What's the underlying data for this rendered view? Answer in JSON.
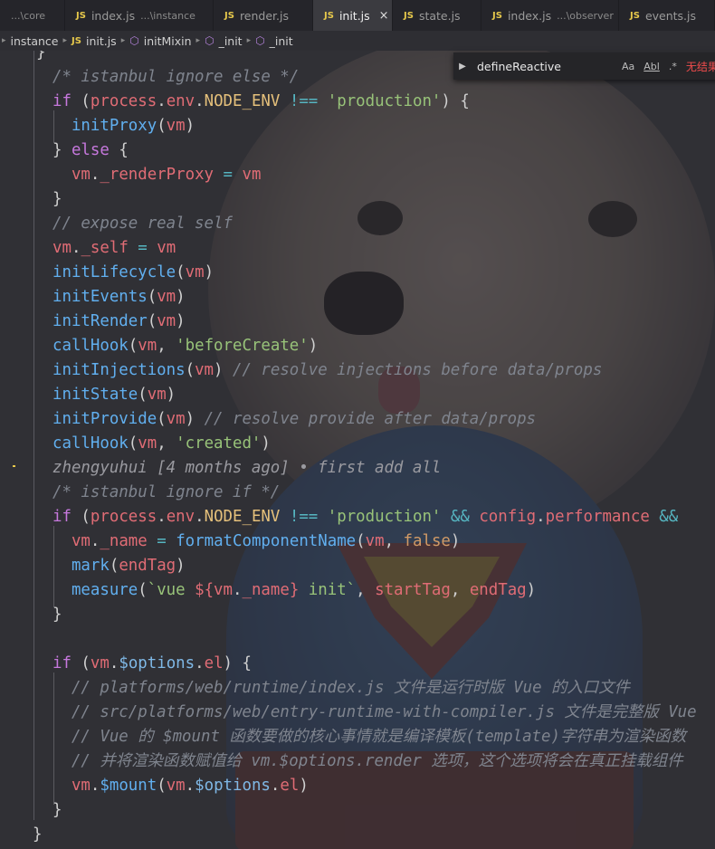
{
  "tabs": [
    {
      "label": "",
      "desc": "...\\core",
      "active": false,
      "js": false
    },
    {
      "label": "index.js",
      "desc": "...\\instance",
      "active": false,
      "js": true
    },
    {
      "label": "render.js",
      "desc": "",
      "active": false,
      "js": true
    },
    {
      "label": "init.js",
      "desc": "",
      "active": true,
      "js": true
    },
    {
      "label": "state.js",
      "desc": "",
      "active": false,
      "js": true
    },
    {
      "label": "index.js",
      "desc": "...\\observer",
      "active": false,
      "js": true
    },
    {
      "label": "events.js",
      "desc": "",
      "active": false,
      "js": true
    }
  ],
  "tab_js_badge": "JS",
  "tab_close_glyph": "×",
  "breadcrumb": {
    "folder": "instance",
    "file": "init.js",
    "symbols": [
      "initMixin",
      "_init",
      "_init"
    ]
  },
  "find": {
    "query": "defineReactive",
    "match_case": "Aa",
    "whole_word": "Abl",
    "regex": ".*",
    "result": "无结果"
  },
  "code": [
    {
      "tokens": [
        [
          "pl",
          "}"
        ]
      ]
    },
    {
      "tokens": [
        [
          "cm",
          "/* istanbul ignore else */"
        ]
      ]
    },
    {
      "tokens": [
        [
          "kw",
          "if"
        ],
        [
          "pl",
          " ("
        ],
        [
          "vr",
          "process"
        ],
        [
          "pl",
          "."
        ],
        [
          "vr",
          "env"
        ],
        [
          "pl",
          "."
        ],
        [
          "pa",
          "NODE_ENV"
        ],
        [
          "pl",
          " "
        ],
        [
          "op",
          "!=="
        ],
        [
          "pl",
          " "
        ],
        [
          "str",
          "'production'"
        ],
        [
          "pl",
          ") {"
        ]
      ]
    },
    {
      "tokens": [
        [
          "pl",
          "  "
        ],
        [
          "fn",
          "initProxy"
        ],
        [
          "pl",
          "("
        ],
        [
          "vr",
          "vm"
        ],
        [
          "pl",
          ")"
        ]
      ]
    },
    {
      "tokens": [
        [
          "pl",
          "} "
        ],
        [
          "kw",
          "else"
        ],
        [
          "pl",
          " {"
        ]
      ]
    },
    {
      "tokens": [
        [
          "pl",
          "  "
        ],
        [
          "vr",
          "vm"
        ],
        [
          "pl",
          "."
        ],
        [
          "vr",
          "_renderProxy"
        ],
        [
          "pl",
          " "
        ],
        [
          "op",
          "="
        ],
        [
          "pl",
          " "
        ],
        [
          "vr",
          "vm"
        ]
      ]
    },
    {
      "tokens": [
        [
          "pl",
          "}"
        ]
      ]
    },
    {
      "tokens": [
        [
          "cm",
          "// expose real self"
        ]
      ]
    },
    {
      "tokens": [
        [
          "vr",
          "vm"
        ],
        [
          "pl",
          "."
        ],
        [
          "vr",
          "_self"
        ],
        [
          "pl",
          " "
        ],
        [
          "op",
          "="
        ],
        [
          "pl",
          " "
        ],
        [
          "vr",
          "vm"
        ]
      ]
    },
    {
      "tokens": [
        [
          "fn",
          "initLifecycle"
        ],
        [
          "pl",
          "("
        ],
        [
          "vr",
          "vm"
        ],
        [
          "pl",
          ")"
        ]
      ]
    },
    {
      "tokens": [
        [
          "fn",
          "initEvents"
        ],
        [
          "pl",
          "("
        ],
        [
          "vr",
          "vm"
        ],
        [
          "pl",
          ")"
        ]
      ]
    },
    {
      "tokens": [
        [
          "fn",
          "initRender"
        ],
        [
          "pl",
          "("
        ],
        [
          "vr",
          "vm"
        ],
        [
          "pl",
          ")"
        ]
      ]
    },
    {
      "tokens": [
        [
          "fn",
          "callHook"
        ],
        [
          "pl",
          "("
        ],
        [
          "vr",
          "vm"
        ],
        [
          "pl",
          ", "
        ],
        [
          "str",
          "'beforeCreate'"
        ],
        [
          "pl",
          ")"
        ]
      ]
    },
    {
      "tokens": [
        [
          "fn",
          "initInjections"
        ],
        [
          "pl",
          "("
        ],
        [
          "vr",
          "vm"
        ],
        [
          "pl",
          ") "
        ],
        [
          "cm",
          "// resolve injections before data/props"
        ]
      ]
    },
    {
      "tokens": [
        [
          "fn",
          "initState"
        ],
        [
          "pl",
          "("
        ],
        [
          "vr",
          "vm"
        ],
        [
          "pl",
          ")"
        ]
      ]
    },
    {
      "tokens": [
        [
          "fn",
          "initProvide"
        ],
        [
          "pl",
          "("
        ],
        [
          "vr",
          "vm"
        ],
        [
          "pl",
          ") "
        ],
        [
          "cm",
          "// resolve provide after data/props"
        ]
      ]
    },
    {
      "tokens": [
        [
          "fn",
          "callHook"
        ],
        [
          "pl",
          "("
        ],
        [
          "vr",
          "vm"
        ],
        [
          "pl",
          ", "
        ],
        [
          "str",
          "'created'"
        ],
        [
          "pl",
          ")"
        ]
      ]
    },
    {
      "tokens": [
        [
          "blame",
          "zhengyuhui [4 months ago] • first add all"
        ]
      ]
    },
    {
      "tokens": [
        [
          "cm",
          "/* istanbul ignore if */"
        ]
      ]
    },
    {
      "tokens": [
        [
          "kw",
          "if"
        ],
        [
          "pl",
          " ("
        ],
        [
          "vr",
          "process"
        ],
        [
          "pl",
          "."
        ],
        [
          "vr",
          "env"
        ],
        [
          "pl",
          "."
        ],
        [
          "pa",
          "NODE_ENV"
        ],
        [
          "pl",
          " "
        ],
        [
          "op",
          "!=="
        ],
        [
          "pl",
          " "
        ],
        [
          "str",
          "'production'"
        ],
        [
          "pl",
          " "
        ],
        [
          "op",
          "&&"
        ],
        [
          "pl",
          " "
        ],
        [
          "vr",
          "config"
        ],
        [
          "pl",
          "."
        ],
        [
          "vr",
          "performance"
        ],
        [
          "pl",
          " "
        ],
        [
          "op",
          "&&"
        ]
      ]
    },
    {
      "tokens": [
        [
          "pl",
          "  "
        ],
        [
          "vr",
          "vm"
        ],
        [
          "pl",
          "."
        ],
        [
          "vr",
          "_name"
        ],
        [
          "pl",
          " "
        ],
        [
          "op",
          "="
        ],
        [
          "pl",
          " "
        ],
        [
          "fn",
          "formatComponentName"
        ],
        [
          "pl",
          "("
        ],
        [
          "vr",
          "vm"
        ],
        [
          "pl",
          ", "
        ],
        [
          "cst",
          "false"
        ],
        [
          "pl",
          ")"
        ]
      ]
    },
    {
      "tokens": [
        [
          "pl",
          "  "
        ],
        [
          "fn",
          "mark"
        ],
        [
          "pl",
          "("
        ],
        [
          "vr",
          "endTag"
        ],
        [
          "pl",
          ")"
        ]
      ]
    },
    {
      "tokens": [
        [
          "pl",
          "  "
        ],
        [
          "fn",
          "measure"
        ],
        [
          "pl",
          "("
        ],
        [
          "str",
          "`vue "
        ],
        [
          "vr",
          "${"
        ],
        [
          "vr",
          "vm"
        ],
        [
          "pl",
          "."
        ],
        [
          "vr",
          "_name"
        ],
        [
          "vr",
          "}"
        ],
        [
          "str",
          " init`"
        ],
        [
          "pl",
          ", "
        ],
        [
          "vr",
          "startTag"
        ],
        [
          "pl",
          ", "
        ],
        [
          "vr",
          "endTag"
        ],
        [
          "pl",
          ")"
        ]
      ]
    },
    {
      "tokens": [
        [
          "pl",
          "}"
        ]
      ]
    },
    {
      "tokens": [
        [
          "pl",
          ""
        ]
      ]
    },
    {
      "tokens": [
        [
          "kw",
          "if"
        ],
        [
          "pl",
          " ("
        ],
        [
          "vr",
          "vm"
        ],
        [
          "pl",
          "."
        ],
        [
          "bl",
          "$options"
        ],
        [
          "pl",
          "."
        ],
        [
          "vr",
          "el"
        ],
        [
          "pl",
          ") {"
        ]
      ]
    },
    {
      "tokens": [
        [
          "pl",
          "  "
        ],
        [
          "cm",
          "// platforms/web/runtime/index.js 文件是运行时版 Vue 的入口文件"
        ]
      ]
    },
    {
      "tokens": [
        [
          "pl",
          "  "
        ],
        [
          "cm",
          "// src/platforms/web/entry-runtime-with-compiler.js 文件是完整版 Vue"
        ]
      ]
    },
    {
      "tokens": [
        [
          "pl",
          "  "
        ],
        [
          "cm",
          "// Vue 的 $mount 函数要做的核心事情就是编译模板(template)字符串为渲染函数"
        ]
      ]
    },
    {
      "tokens": [
        [
          "pl",
          "  "
        ],
        [
          "cm",
          "// 并将渲染函数赋值给 vm.$options.render 选项，这个选项将会在真正挂载组件"
        ]
      ]
    },
    {
      "tokens": [
        [
          "pl",
          "  "
        ],
        [
          "vr",
          "vm"
        ],
        [
          "pl",
          "."
        ],
        [
          "fn",
          "$mount"
        ],
        [
          "pl",
          "("
        ],
        [
          "vr",
          "vm"
        ],
        [
          "pl",
          "."
        ],
        [
          "bl",
          "$options"
        ],
        [
          "pl",
          "."
        ],
        [
          "vr",
          "el"
        ],
        [
          "pl",
          ")"
        ]
      ]
    },
    {
      "tokens": [
        [
          "pl",
          "}"
        ]
      ]
    },
    {
      "tokens": [
        [
          "pl",
          "}"
        ]
      ]
    }
  ],
  "colors": {
    "keyword": "#c678dd",
    "string": "#98c379",
    "comment": "#7f848e",
    "function": "#61afef",
    "variable": "#e06c75",
    "js_badge": "#e6c84b",
    "find_no_result": "#f14c4c"
  }
}
